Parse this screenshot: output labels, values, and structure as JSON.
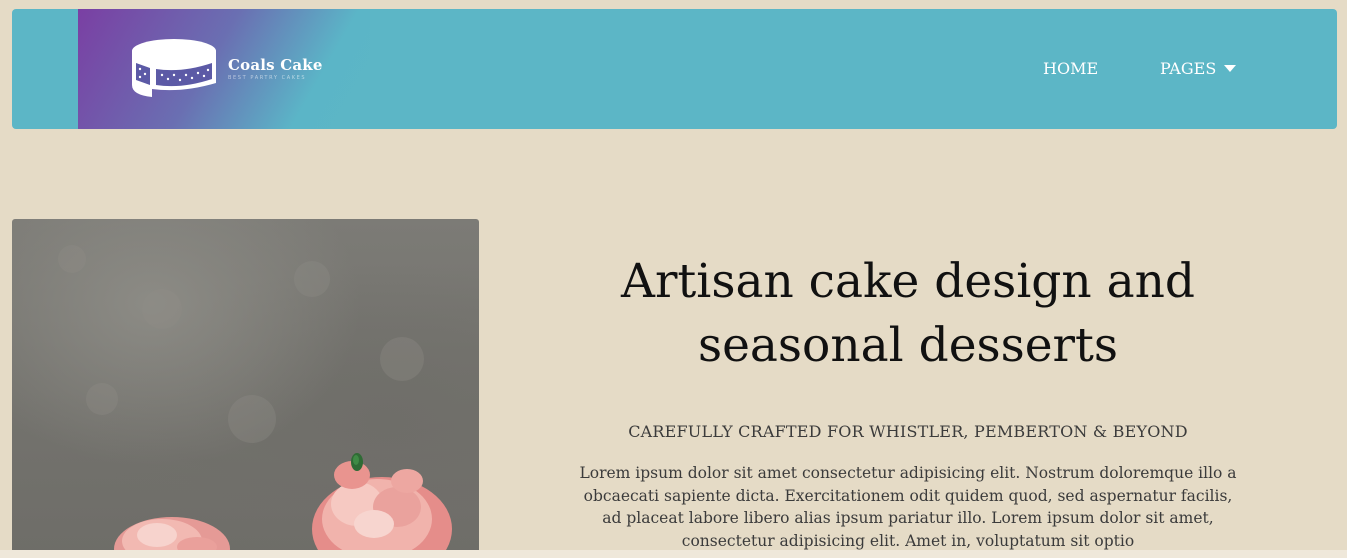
{
  "brand": {
    "name": "Coals Cake",
    "tagline": "BEST PARTRY CAKES"
  },
  "nav": {
    "items": [
      {
        "label": "HOME"
      },
      {
        "label": "PAGES",
        "icon": "caret-down-icon"
      }
    ]
  },
  "hero": {
    "title": "Artisan cake design and seasonal desserts",
    "subtitle": "CAREFULLY CRAFTED FOR WHISTLER, PEMBERTON & BEYOND",
    "body": "Lorem ipsum dolor sit amet consectetur adipisicing elit. Nostrum doloremque illo a obcaecati sapiente dicta. Exercitationem odit quidem quod, sed aspernatur facilis, ad placeat labore libero alias ipsum pariatur illo. Lorem ipsum dolor sit amet, consectetur adipisicing elit. Amet in, voluptatum sit optio"
  },
  "colors": {
    "background": "#e5dbc6",
    "navbar": "#5cb6c6",
    "logo_gradient_start": "#7a3fa3",
    "logo_gradient_end": "#5cb6c6",
    "text_dark": "#111111",
    "text_body": "#3b3b3b"
  }
}
